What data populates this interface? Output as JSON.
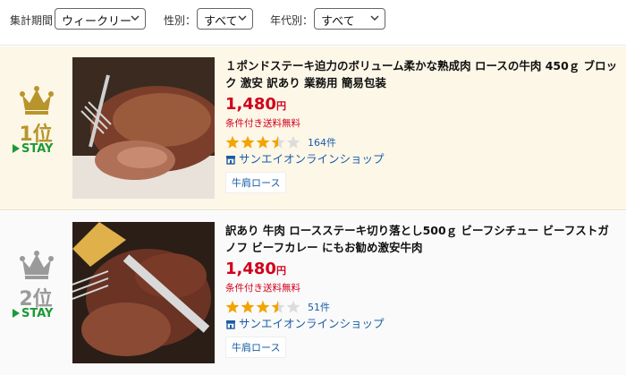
{
  "filters": [
    {
      "label": "集計期間：",
      "value": "ウィークリー"
    },
    {
      "label": "性別：",
      "value": "すべて"
    },
    {
      "label": "年代別：",
      "value": "すべて"
    }
  ],
  "items": [
    {
      "rank_text": "1位",
      "status": "STAY",
      "title": "１ポンドステーキ迫力のボリューム柔かな熟成肉 ロースの牛肉 450ｇ ブロック 激安 訳あり 業務用 簡易包装",
      "price": "1,480",
      "currency": "円",
      "shipping": "条件付き送料無料",
      "rating": 3.5,
      "reviews": "164件",
      "shop": "サンエイオンラインショップ",
      "tag": "牛肩ロース",
      "crown_color": "#b8952c"
    },
    {
      "rank_text": "2位",
      "status": "STAY",
      "title": "訳あり 牛肉 ロースステーキ切り落とし500ｇ ビーフシチュー ビーフストガノフ ビーフカレー にもお勧め激安牛肉",
      "price": "1,480",
      "currency": "円",
      "shipping": "条件付き送料無料",
      "rating": 3.5,
      "reviews": "51件",
      "shop": "サンエイオンラインショップ",
      "tag": "牛肩ロース",
      "crown_color": "#9a9a9a"
    }
  ],
  "colors": {
    "price": "#d1001c",
    "link": "#1a5da6",
    "stay": "#1c9a36",
    "star_on": "#f2a400",
    "star_off": "#dcdcdc"
  }
}
